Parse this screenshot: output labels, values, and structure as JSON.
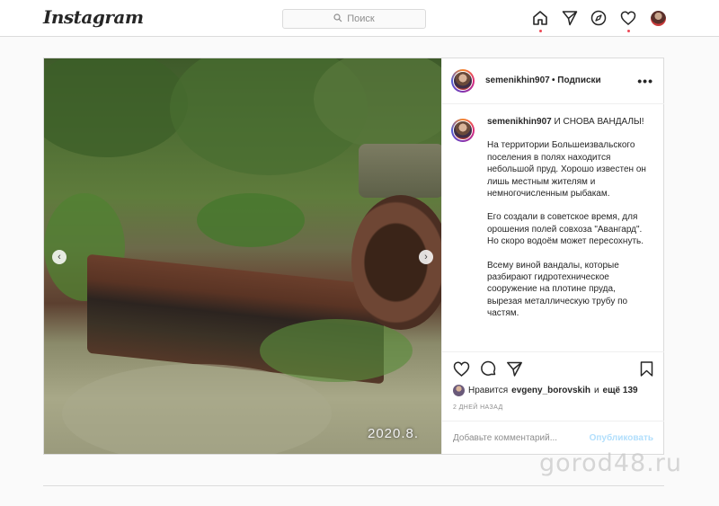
{
  "nav": {
    "logo": "Instagram",
    "search_placeholder": "Поиск"
  },
  "post": {
    "username": "semenikhin907",
    "follow_label": "• Подписки",
    "more_label": "•••",
    "caption_title": "И СНОВА ВАНДАЛЫ!",
    "caption_paragraphs": [
      "На территории Большеизвальского поселения в полях находится небольшой пруд. Хорошо известен он лишь местным жителям и немногочисленным рыбакам.",
      "Его создали в советское время, для орошения полей совхоза \"Авангард\". Но скоро водоём может пересохнуть.",
      "Всему виной вандалы, которые разбирают гидротехническое сооружение на плотине пруда, вырезая металлическую трубу по частям."
    ],
    "photo_timestamp": "2020.8.",
    "likes_prefix": "Нравится",
    "likes_user": "evgeny_borovskih",
    "likes_joiner": "и",
    "likes_rest": "ещё 139",
    "date": "2 ДНЕЙ НАЗАД",
    "comment_placeholder": "Добавьте комментарий...",
    "publish_label": "Опубликовать"
  },
  "watermark": "gorod48.ru",
  "colors": {
    "border": "#dbdbdb",
    "notification_dot": "#ed4956",
    "publish_disabled": "#b2dffc",
    "muted_text": "#8e8e8e"
  },
  "icons": [
    "search-icon",
    "home-icon",
    "direct-icon",
    "explore-icon",
    "heart-icon",
    "comment-icon",
    "share-icon",
    "bookmark-icon",
    "chevron-left-icon",
    "chevron-right-icon"
  ]
}
